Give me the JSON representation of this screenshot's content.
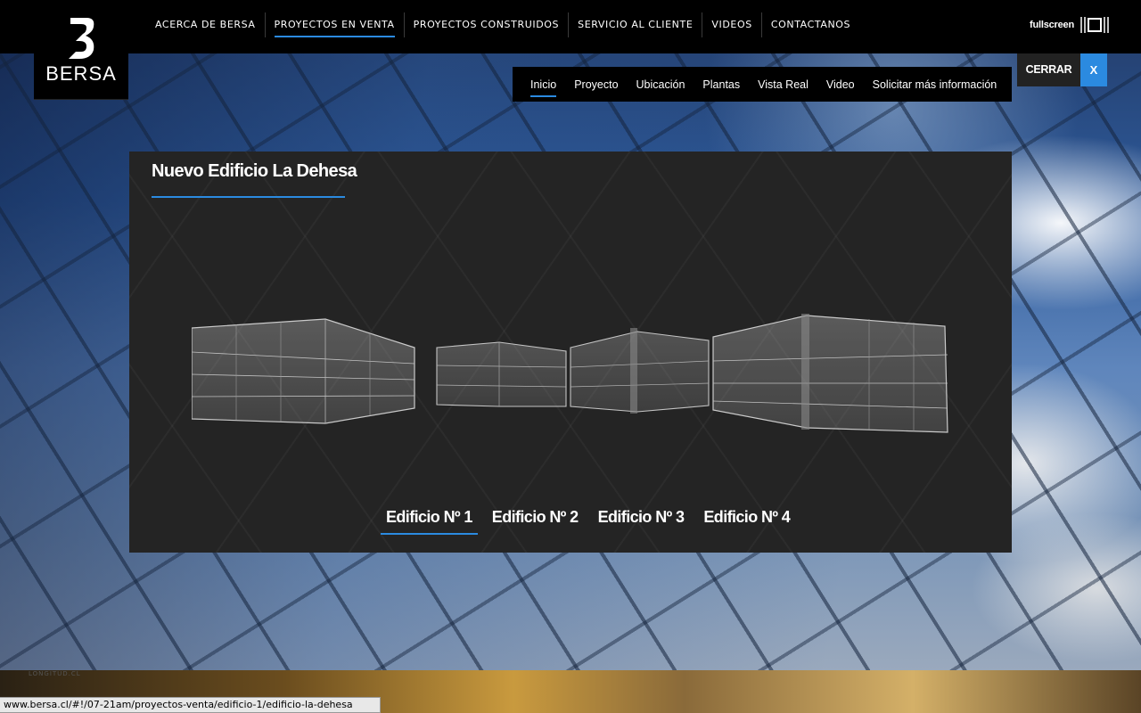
{
  "brand": {
    "name": "BERSA"
  },
  "mainnav": {
    "items": [
      {
        "label": "ACERCA DE BERSA"
      },
      {
        "label": "PROYECTOS EN VENTA"
      },
      {
        "label": "PROYECTOS CONSTRUIDOS"
      },
      {
        "label": "SERVICIO AL CLIENTE"
      },
      {
        "label": "VIDEOS"
      },
      {
        "label": "CONTACTANOS"
      }
    ],
    "active_index": 1
  },
  "fullscreen": {
    "label": "fullscreen",
    "icon": "fullscreen-icon"
  },
  "subnav": {
    "items": [
      {
        "label": "Inicio"
      },
      {
        "label": "Proyecto"
      },
      {
        "label": "Ubicación"
      },
      {
        "label": "Plantas"
      },
      {
        "label": "Vista Real"
      },
      {
        "label": "Video"
      },
      {
        "label": "Solicitar más información"
      }
    ],
    "active_index": 0
  },
  "close": {
    "label": "CERRAR",
    "x": "X"
  },
  "panel": {
    "title": "Nuevo Edificio La Dehesa",
    "tabs": [
      {
        "label": "Edificio Nº 1"
      },
      {
        "label": "Edificio Nº 2"
      },
      {
        "label": "Edificio Nº 3"
      },
      {
        "label": "Edificio Nº 4"
      }
    ],
    "active_tab": 0
  },
  "watermark": "LONGITUD.CL",
  "statusbar": {
    "url": "www.bersa.cl/#!/07-21am/proyectos-venta/edificio-1/edificio-la-dehesa"
  },
  "colors": {
    "accent": "#2b8ae0",
    "bar": "#000000",
    "panel": "#242424"
  }
}
